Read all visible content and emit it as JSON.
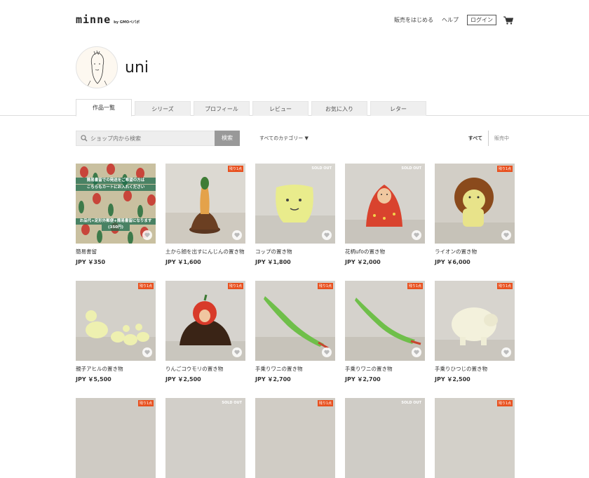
{
  "header": {
    "logo": "minne",
    "logo_sub": "by GMOペパボ",
    "nav": {
      "start_selling": "販売をはじめる",
      "help": "ヘルプ",
      "login": "ログイン"
    }
  },
  "shop": {
    "name": "uni"
  },
  "tabs": [
    "作品一覧",
    "シリーズ",
    "プロフィール",
    "レビュー",
    "お気に入り",
    "レター"
  ],
  "search": {
    "placeholder": "ショップ内から検索",
    "button": "検索"
  },
  "filters": {
    "category": "すべてのカテゴリー ▼",
    "all": "すべて",
    "on_sale": "販売中"
  },
  "products": [
    {
      "name": "簡易書留",
      "price": "JPY ￥350",
      "badge": "",
      "notice1": "簡易書留での発送をご希望の方は",
      "notice2": "こちらもカートにお入れください",
      "notice3": "お品代+定形外郵便+簡易書留になります",
      "notice4": "(350円)"
    },
    {
      "name": "土から顔を出すにんじんの置き物",
      "price": "JPY ￥1,600",
      "badge": "残り1点"
    },
    {
      "name": "コップの置き物",
      "price": "JPY ￥1,800",
      "badge": "SOLD OUT"
    },
    {
      "name": "花柄ufoの置き物",
      "price": "JPY ￥2,000",
      "badge": "SOLD OUT"
    },
    {
      "name": "ライオンの置き物",
      "price": "JPY ￥6,000",
      "badge": "残り1点"
    },
    {
      "name": "親子アヒルの置き物",
      "price": "JPY ￥5,500",
      "badge": "残り1点"
    },
    {
      "name": "りんごコウモリの置き物",
      "price": "JPY ￥2,500",
      "badge": "残り1点"
    },
    {
      "name": "手乗りワニの置き物",
      "price": "JPY ￥2,700",
      "badge": "残り1点"
    },
    {
      "name": "手乗りワニの置き物",
      "price": "JPY ￥2,700",
      "badge": "残り1点"
    },
    {
      "name": "手乗りひつじの置き物",
      "price": "JPY ￥2,500",
      "badge": "残り1点"
    },
    {
      "name": "",
      "price": "",
      "badge": "残り1点"
    },
    {
      "name": "",
      "price": "",
      "badge": "SOLD OUT"
    },
    {
      "name": "",
      "price": "",
      "badge": "残り1点"
    },
    {
      "name": "",
      "price": "",
      "badge": "SOLD OUT"
    },
    {
      "name": "",
      "price": "",
      "badge": "残り1点"
    }
  ],
  "colors": {
    "accent_badge": "#e8501e",
    "search_button": "#999999"
  }
}
